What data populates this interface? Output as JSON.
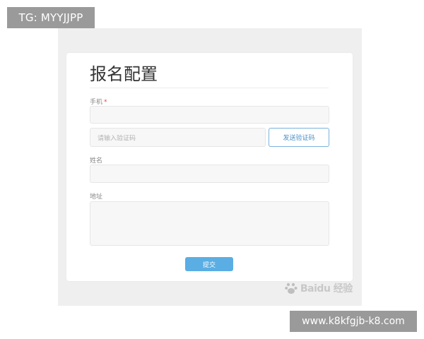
{
  "overlay": {
    "tg_handle": "TG: MYYJJPP",
    "site_url": "www.k8kfgjb-k8.com"
  },
  "form": {
    "title": "报名配置",
    "phone": {
      "label": "手机",
      "required_mark": "*",
      "value": ""
    },
    "code": {
      "placeholder": "请输入验证码",
      "value": ""
    },
    "send_code_label": "发送验证码",
    "name": {
      "label": "姓名",
      "value": ""
    },
    "address": {
      "label": "地址",
      "value": ""
    },
    "submit_label": "提交"
  },
  "watermark": {
    "text": "Baidu 经验"
  },
  "colors": {
    "submit_button": "#5aaee3",
    "send_code_border": "#7ab3dc",
    "required_mark": "#e04848"
  }
}
